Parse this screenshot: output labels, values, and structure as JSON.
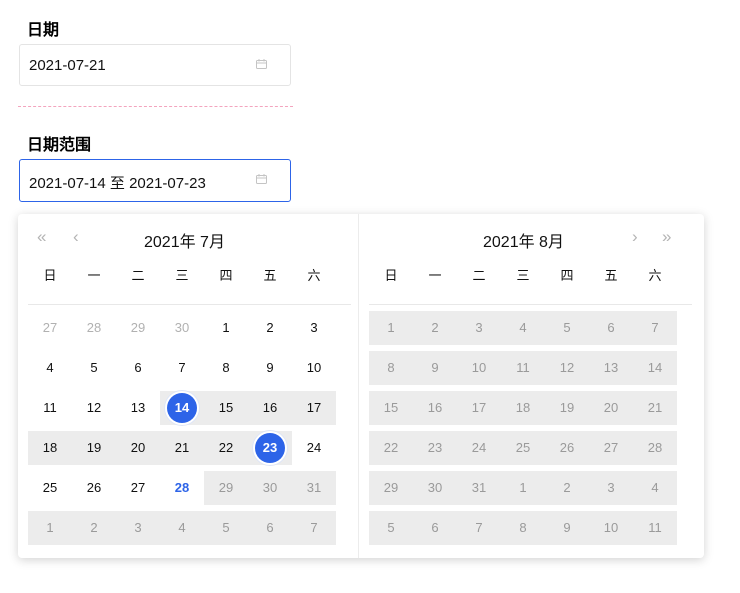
{
  "date_field": {
    "label": "日期",
    "value": "2021-07-21",
    "icon": "calendar-icon"
  },
  "range_field": {
    "label": "日期范围",
    "value": "2021-07-14 至 2021-07-23",
    "icon": "calendar-icon"
  },
  "picker": {
    "accent": "#2d64e8",
    "weekdays": [
      "日",
      "一",
      "二",
      "三",
      "四",
      "五",
      "六"
    ],
    "nav": {
      "prev_year": "«",
      "prev_month": "‹",
      "next_month": "›",
      "next_year": "»"
    },
    "left": {
      "title": "2021年  7月",
      "weeks": [
        [
          "27",
          "28",
          "29",
          "30",
          "1",
          "2",
          "3"
        ],
        [
          "4",
          "5",
          "6",
          "7",
          "8",
          "9",
          "10"
        ],
        [
          "11",
          "12",
          "13",
          "14",
          "15",
          "16",
          "17"
        ],
        [
          "18",
          "19",
          "20",
          "21",
          "22",
          "23",
          "24"
        ],
        [
          "25",
          "26",
          "27",
          "28",
          "29",
          "30",
          "31"
        ],
        [
          "1",
          "2",
          "3",
          "4",
          "5",
          "6",
          "7"
        ]
      ],
      "selected_start": "14",
      "selected_end": "23",
      "today": "28"
    },
    "right": {
      "title": "2021年  8月",
      "weeks": [
        [
          "1",
          "2",
          "3",
          "4",
          "5",
          "6",
          "7"
        ],
        [
          "8",
          "9",
          "10",
          "11",
          "12",
          "13",
          "14"
        ],
        [
          "15",
          "16",
          "17",
          "18",
          "19",
          "20",
          "21"
        ],
        [
          "22",
          "23",
          "24",
          "25",
          "26",
          "27",
          "28"
        ],
        [
          "29",
          "30",
          "31",
          "1",
          "2",
          "3",
          "4"
        ],
        [
          "5",
          "6",
          "7",
          "8",
          "9",
          "10",
          "11"
        ]
      ]
    }
  }
}
